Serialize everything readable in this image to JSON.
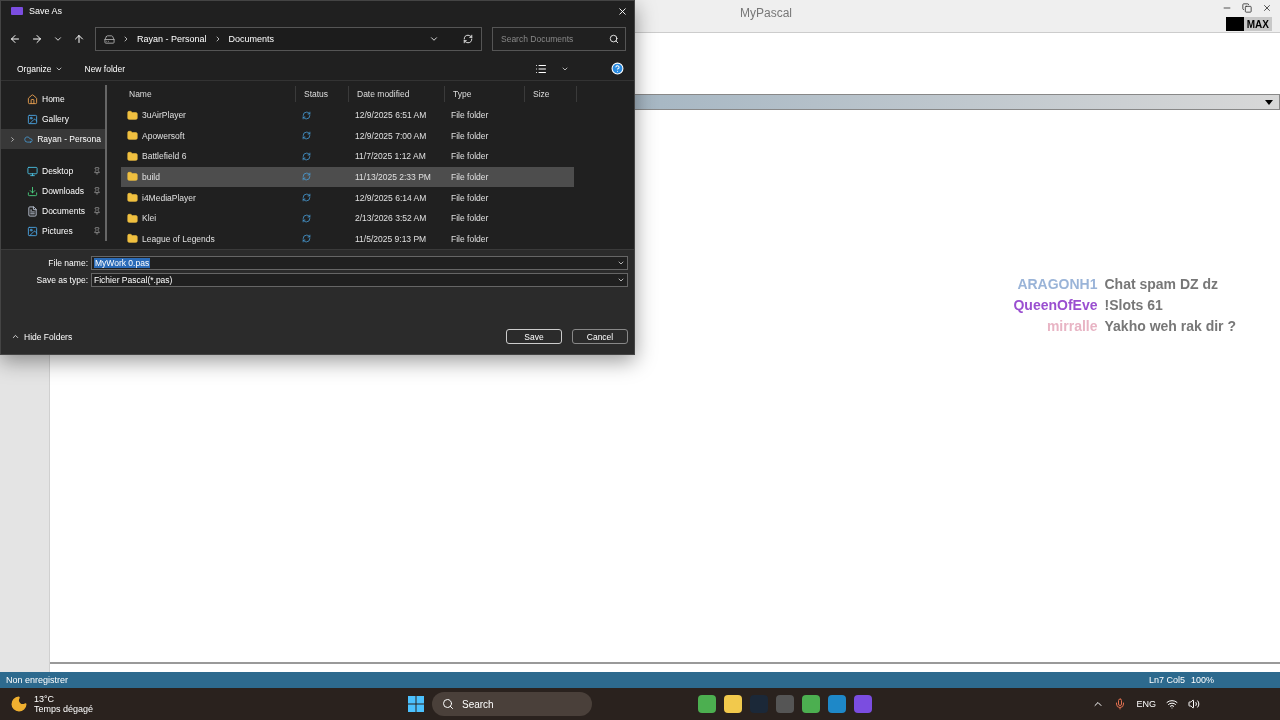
{
  "app": {
    "title": "MyPascal",
    "max_label": "MAX",
    "status_bar": {
      "left": "Non enregistrer",
      "position": "Ln7 Col5",
      "zoom": "100%"
    }
  },
  "dialog": {
    "title": "Save As",
    "breadcrumb": [
      "Rayan - Personal",
      "Documents"
    ],
    "search": {
      "placeholder": "Search Documents"
    },
    "toolbar": [
      {
        "label": "Organize",
        "kind": "menu"
      },
      {
        "label": "New folder",
        "kind": "plain"
      }
    ],
    "nav": [
      {
        "label": "Home",
        "kind": "home",
        "selected": false,
        "pinned": false,
        "expandable": false
      },
      {
        "label": "Gallery",
        "kind": "gallery",
        "selected": false,
        "pinned": false,
        "expandable": false
      },
      {
        "label": "Rayan - Persona",
        "kind": "cloud",
        "selected": true,
        "pinned": false,
        "expandable": true
      },
      {
        "label": "Desktop",
        "kind": "desktop",
        "selected": false,
        "pinned": true,
        "expandable": false
      },
      {
        "label": "Downloads",
        "kind": "downloads",
        "selected": false,
        "pinned": true,
        "expandable": false
      },
      {
        "label": "Documents",
        "kind": "documents",
        "selected": false,
        "pinned": true,
        "expandable": false
      },
      {
        "label": "Pictures",
        "kind": "pictures",
        "selected": false,
        "pinned": true,
        "expandable": false
      }
    ],
    "columns": [
      "Name",
      "Status",
      "Date modified",
      "Type",
      "Size"
    ],
    "rows": [
      {
        "name": "3uAirPlayer",
        "date": "12/9/2025 6:51 AM",
        "type": "File folder",
        "selected": false
      },
      {
        "name": "Apowersoft",
        "date": "12/9/2025 7:00 AM",
        "type": "File folder",
        "selected": false
      },
      {
        "name": "Battlefield 6",
        "date": "11/7/2025 1:12 AM",
        "type": "File folder",
        "selected": false
      },
      {
        "name": "build",
        "date": "11/13/2025 2:33 PM",
        "type": "File folder",
        "selected": true
      },
      {
        "name": "i4MediaPlayer",
        "date": "12/9/2025 6:14 AM",
        "type": "File folder",
        "selected": false
      },
      {
        "name": "Klei",
        "date": "2/13/2026 3:52 AM",
        "type": "File folder",
        "selected": false
      },
      {
        "name": "League of Legends",
        "date": "11/5/2025 9:13 PM",
        "type": "File folder",
        "selected": false
      }
    ],
    "file_name": {
      "label": "File name:",
      "value": "MyWork 0.pas",
      "selected": true
    },
    "save_as_type": {
      "label": "Save as type:",
      "value": "Fichier Pascal(*.pas)"
    },
    "hide_folders": "Hide Folders",
    "buttons": [
      "Save",
      "Cancel"
    ]
  },
  "chat": [
    {
      "user": "ARAGONH1",
      "color": "#9ab4d8",
      "message": "Chat spam DZ dz"
    },
    {
      "user": "QueenOfEve",
      "color": "#9a4fd0",
      "message": "!Slots 61"
    },
    {
      "user": "mirralle",
      "color": "#e8b4c4",
      "message": "Yakho weh rak dir ?"
    }
  ],
  "taskbar": {
    "temp": "13°C",
    "weather": "Temps dégagé",
    "search": "Search",
    "lang": "ENG"
  }
}
